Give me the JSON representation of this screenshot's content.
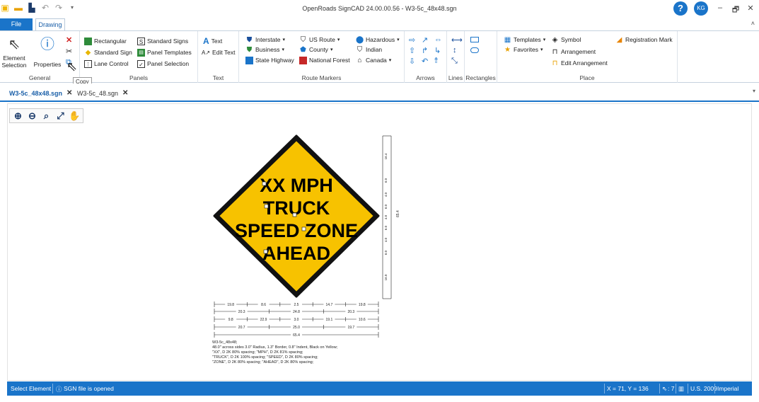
{
  "window": {
    "title": "OpenRoads SignCAD 24.00.00.56 - W3-5c_48x48.sgn",
    "user_initials": "KG",
    "help_symbol": "?",
    "controls": {
      "minimize": "–",
      "restore": "🗗",
      "close": "✕"
    }
  },
  "qat": {
    "icons": [
      "app-icon",
      "open-icon",
      "save-icon",
      "undo-icon",
      "redo-icon",
      "customize-icon"
    ]
  },
  "tabs": {
    "file": "File",
    "drawing": "Drawing",
    "collapse": "˄"
  },
  "ribbon": {
    "general": {
      "title": "General",
      "element_selection": "Element\nSelection",
      "properties": "Properties"
    },
    "panels": {
      "title": "Panels",
      "rectangular": "Rectangular",
      "standard_sign": "Standard Sign",
      "lane_control": "Lane Control",
      "standard_signs": "Standard Signs",
      "panel_templates": "Panel Templates",
      "panel_selection": "Panel Selection"
    },
    "text": {
      "title": "Text",
      "text": "Text",
      "edit_text": "Edit Text"
    },
    "route_markers": {
      "title": "Route Markers",
      "interstate": "Interstate",
      "business": "Business",
      "state_highway": "State Highway",
      "us_route": "US Route",
      "county": "County",
      "national_forest": "National Forest",
      "hazardous": "Hazardous",
      "indian": "Indian",
      "canada": "Canada"
    },
    "arrows": {
      "title": "Arrows"
    },
    "lines": {
      "title": "Lines"
    },
    "rectangles": {
      "title": "Rectangles"
    },
    "place": {
      "title": "Place",
      "templates": "Templates",
      "favorites": "Favorites",
      "symbol": "Symbol",
      "arrangement": "Arrangement",
      "edit_arrangement": "Edit Arrangement",
      "registration_mark": "Registration Mark"
    },
    "tooltip": "Copy"
  },
  "doc_tabs": [
    {
      "label": "W3-5c_48x48.sgn",
      "active": true
    },
    {
      "label": "W3-5c_48.sgn",
      "active": false
    }
  ],
  "sign": {
    "lines": [
      "XX MPH",
      "TRUCK",
      "SPEED ZONE",
      "AHEAD"
    ],
    "background_color": "#f7c200",
    "border_color": "#111111",
    "vertical_dims": [
      "16.4",
      "6.0",
      "4.0",
      "6.0",
      "4.0",
      "6.0",
      "4.0",
      "6.0",
      "16.0"
    ],
    "vertical_total": "65.4",
    "horizontal_dims": {
      "row1": [
        "19.8",
        "8.6",
        "2.5",
        "14.7",
        "19.8"
      ],
      "row2": [
        "20.3",
        "24.8",
        "20.3"
      ],
      "row3": [
        "9.8",
        "22.9",
        "3.0",
        "19.1",
        "10.6"
      ],
      "row4": [
        "20.7",
        "25.0",
        "19.7"
      ],
      "row5": [
        "65.4"
      ]
    }
  },
  "notes": [
    "W3-5c_48x48;",
    "48.0\" across sides 3.0\" Radius, 1.3\" Border, 0.8\" Indent, Black on Yellow;",
    "\"XX\",  D 2K 80% spacing; \"MPH\",  D 2K 81% spacing;",
    "\"TRUCK\",  D 2K 100% spacing; \"SPEED\",  D 2K 80% spacing;",
    "\"ZONE\",  D 2K 80% spacing; \"AHEAD\",  D 2K 80% spacing;"
  ],
  "status": {
    "left": "Select Element",
    "message": "SGN file is opened",
    "coords": "X = 71, Y = 136",
    "snap": ": 7",
    "standard": "U.S. 2009",
    "units": "Imperial"
  }
}
